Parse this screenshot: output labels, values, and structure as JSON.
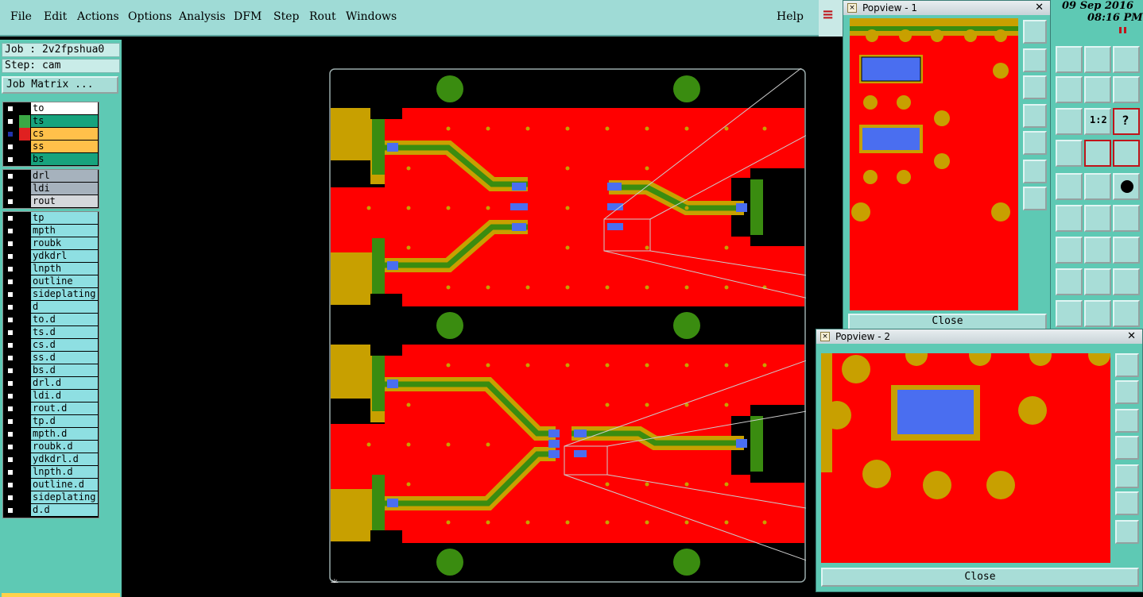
{
  "menubar": {
    "items": [
      "File",
      "Edit",
      "Actions",
      "Options",
      "Analysis",
      "DFM",
      "Step",
      "Rout",
      "Windows"
    ],
    "help": "Help"
  },
  "status": {
    "job": "Job : 2v2fpshua0",
    "step": "Step: cam",
    "job_matrix": "Job Matrix ..."
  },
  "datetime": {
    "date": "09 Sep 2016",
    "time": "08:16 PM"
  },
  "layers": {
    "group1": [
      {
        "name": "to",
        "style": "white",
        "checked": false,
        "swatch": "#000000"
      },
      {
        "name": "ts",
        "style": "teal",
        "checked": false,
        "swatch": "#3aa845"
      },
      {
        "name": "cs",
        "style": "orange",
        "checked": true,
        "swatch": "#e02020"
      },
      {
        "name": "ss",
        "style": "orange",
        "checked": false,
        "swatch": "#000000"
      },
      {
        "name": "bs",
        "style": "teal",
        "checked": false,
        "swatch": "#000000"
      }
    ],
    "group2": [
      {
        "name": "drl",
        "style": "grey",
        "checked": false
      },
      {
        "name": "ldi",
        "style": "grey",
        "checked": false
      },
      {
        "name": "rout",
        "style": "lgrey",
        "checked": false
      }
    ],
    "group3": [
      "tp",
      "mpth",
      "roubk",
      "ydkdrl",
      "lnpth",
      "outline",
      "sideplating",
      "d",
      "to.d",
      "ts.d",
      "cs.d",
      "ss.d",
      "bs.d",
      "drl.d",
      "ldi.d",
      "rout.d",
      "tp.d",
      "mpth.d",
      "roubk.d",
      "ydkdrl.d",
      "lnpth.d",
      "outline.d",
      "sideplating",
      "d.d"
    ]
  },
  "popview1": {
    "title": "Popview - 1",
    "close": "Close"
  },
  "popview2": {
    "title": "Popview - 2",
    "close": "Close"
  },
  "colors": {
    "copper": "#ff0000",
    "mask": "#c8a000",
    "green": "#3a8c10",
    "pad": "#4a6ef0",
    "panel": "#5ec9b4",
    "menu": "#9fdbd6"
  }
}
